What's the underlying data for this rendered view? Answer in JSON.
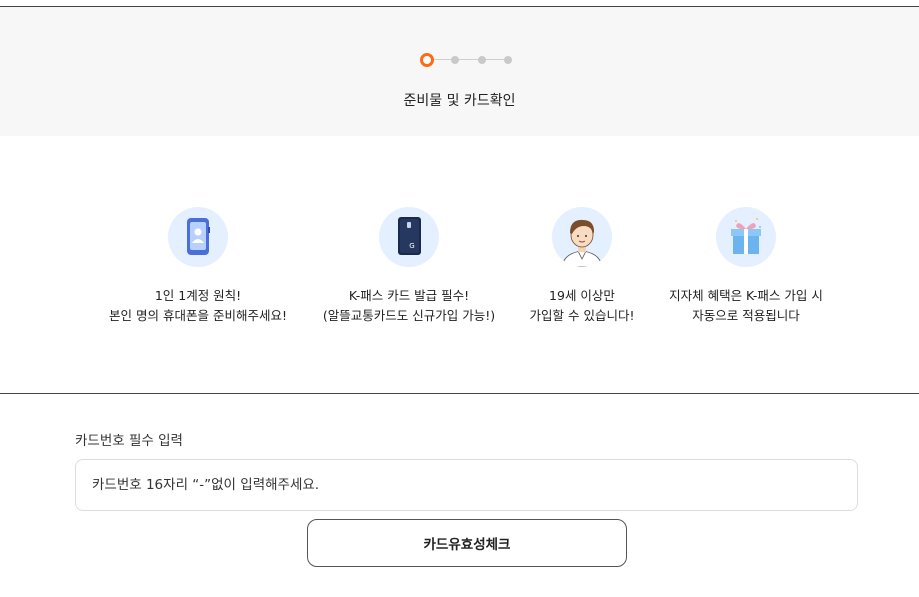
{
  "header": {
    "step_title": "준비물 및 카드확인",
    "steps_total": 4,
    "current_step": 1,
    "accent_color": "#ff6a13"
  },
  "features": [
    {
      "icon": "phone-user-icon",
      "line1": "1인 1계정 원칙!",
      "line2": "본인 명의 휴대폰을 준비해주세요!"
    },
    {
      "icon": "transit-card-icon",
      "line1": "K-패스 카드 발급 필수!",
      "line2": "(알뜰교통카드도 신규가입 가능!)"
    },
    {
      "icon": "person-avatar-icon",
      "line1": "19세 이상만",
      "line2": "가입할 수 있습니다!"
    },
    {
      "icon": "gift-box-icon",
      "line1": "지자체 혜택은 K-패스 가입 시",
      "line2": "자동으로 적용됩니다"
    }
  ],
  "form": {
    "label": "카드번호 필수 입력",
    "placeholder": "카드번호 16자리 “-”없이 입력해주세요.",
    "value": "",
    "button_label": "카드유효성체크"
  }
}
